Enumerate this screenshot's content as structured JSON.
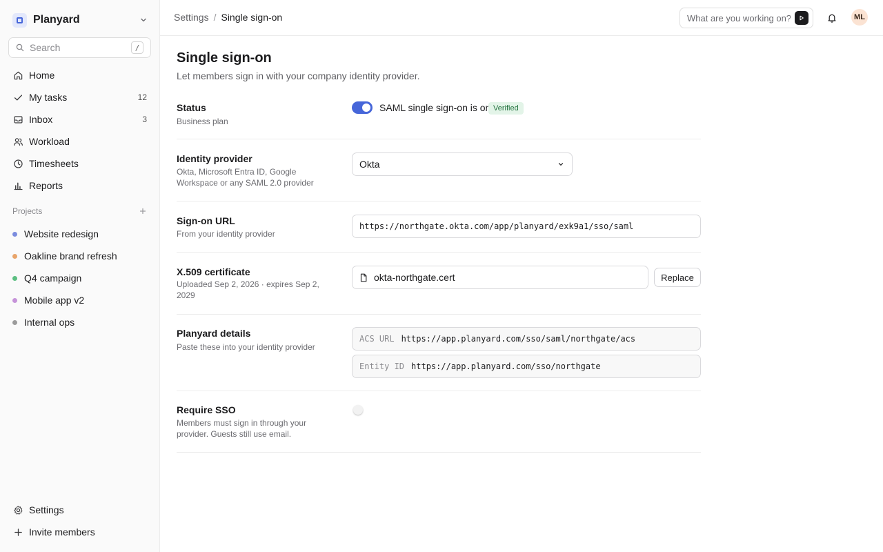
{
  "workspace": {
    "name": "Planyard",
    "logo_color": "#4666d9"
  },
  "search": {
    "placeholder": "Search",
    "shortcut": "/"
  },
  "nav": [
    {
      "label": "Home",
      "icon": "home-icon",
      "count": ""
    },
    {
      "label": "My tasks",
      "icon": "check-icon",
      "count": "12"
    },
    {
      "label": "Inbox",
      "icon": "inbox-icon",
      "count": "3"
    },
    {
      "label": "Workload",
      "icon": "users-icon",
      "count": ""
    },
    {
      "label": "Timesheets",
      "icon": "clock-icon",
      "count": ""
    },
    {
      "label": "Reports",
      "icon": "bar-chart-icon",
      "count": ""
    }
  ],
  "projects": {
    "title": "Projects",
    "items": [
      {
        "label": "Website redesign",
        "color": "#7b8cde"
      },
      {
        "label": "Oakline brand refresh",
        "color": "#e8a46a"
      },
      {
        "label": "Q4 campaign",
        "color": "#5cbf82"
      },
      {
        "label": "Mobile app v2",
        "color": "#c693d9"
      },
      {
        "label": "Internal ops",
        "color": "#9b9b9b"
      }
    ]
  },
  "footer_nav": {
    "settings": "Settings",
    "invite": "Invite members"
  },
  "breadcrumb": {
    "parent": "Settings",
    "separator": "/",
    "current": "Single sign-on"
  },
  "ask": {
    "placeholder": "What are you working on?"
  },
  "user": {
    "initials": "ML"
  },
  "page": {
    "title": "Single sign-on",
    "subtitle": "Let members sign in with your company identity provider."
  },
  "status": {
    "title": "Status",
    "desc": "Business plan",
    "toggle_on": true,
    "text": "SAML single sign-on is on",
    "badge": "Verified"
  },
  "identity_provider": {
    "title": "Identity provider",
    "desc": "Okta, Microsoft Entra ID, Google Workspace or any SAML 2.0 provider",
    "selected": "Okta"
  },
  "sign_on_url": {
    "title": "Sign-on URL",
    "desc": "From your identity provider",
    "value": "https://northgate.okta.com/app/planyard/exk9a1/sso/saml"
  },
  "certificate": {
    "title": "X.509 certificate",
    "desc": "Uploaded Sep 2, 2026 · expires Sep 2, 2029",
    "file": "okta-northgate.cert",
    "button": "Replace"
  },
  "planyard_details": {
    "title": "Planyard details",
    "desc": "Paste these into your identity provider",
    "acs_key": "ACS URL",
    "acs_value": "https://app.planyard.com/sso/saml/northgate/acs",
    "entity_key": "Entity ID",
    "entity_value": "https://app.planyard.com/sso/northgate"
  },
  "require_sso": {
    "title": "Require SSO",
    "desc": "Members must sign in through your provider. Guests still use email.",
    "toggle_on": false
  }
}
